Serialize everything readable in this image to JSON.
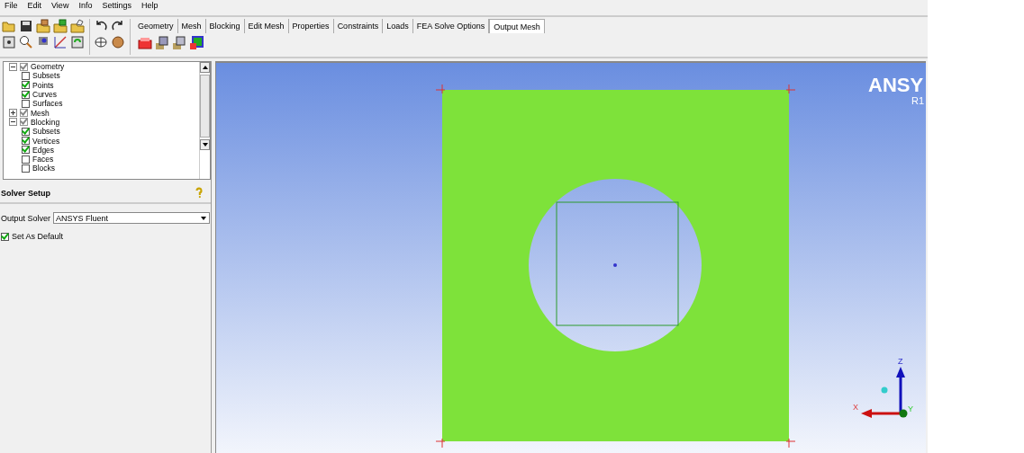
{
  "menu": [
    "File",
    "Edit",
    "View",
    "Info",
    "Settings",
    "Help"
  ],
  "tabs": [
    {
      "label": "Geometry",
      "selected": false
    },
    {
      "label": "Mesh",
      "selected": false
    },
    {
      "label": "Blocking",
      "selected": false
    },
    {
      "label": "Edit Mesh",
      "selected": false
    },
    {
      "label": "Properties",
      "selected": false
    },
    {
      "label": "Constraints",
      "selected": false
    },
    {
      "label": "Loads",
      "selected": false
    },
    {
      "label": "FEA Solve Options",
      "selected": false
    },
    {
      "label": "Output Mesh",
      "selected": true
    }
  ],
  "tree": [
    {
      "label": "Geometry",
      "checked": true,
      "expanded": true,
      "children": [
        {
          "label": "Subsets",
          "checked": false
        },
        {
          "label": "Points",
          "checked": true
        },
        {
          "label": "Curves",
          "checked": true
        },
        {
          "label": "Surfaces",
          "checked": false
        }
      ]
    },
    {
      "label": "Mesh",
      "checked": true,
      "expanded": false
    },
    {
      "label": "Blocking",
      "checked": true,
      "expanded": true,
      "children": [
        {
          "label": "Subsets",
          "checked": true
        },
        {
          "label": "Vertices",
          "checked": true
        },
        {
          "label": "Edges",
          "checked": true
        },
        {
          "label": "Faces",
          "checked": false
        },
        {
          "label": "Blocks",
          "checked": false
        }
      ]
    }
  ],
  "panel": {
    "title": "Solver Setup",
    "output_solver_label": "Output Solver",
    "output_solver_value": "ANSYS Fluent",
    "set_as_default": {
      "label": "Set As Default",
      "checked": true
    }
  },
  "viewport": {
    "logo": "ANSY",
    "version": "R1",
    "axes": {
      "z": "Z",
      "x": "X",
      "y": "Y"
    }
  }
}
